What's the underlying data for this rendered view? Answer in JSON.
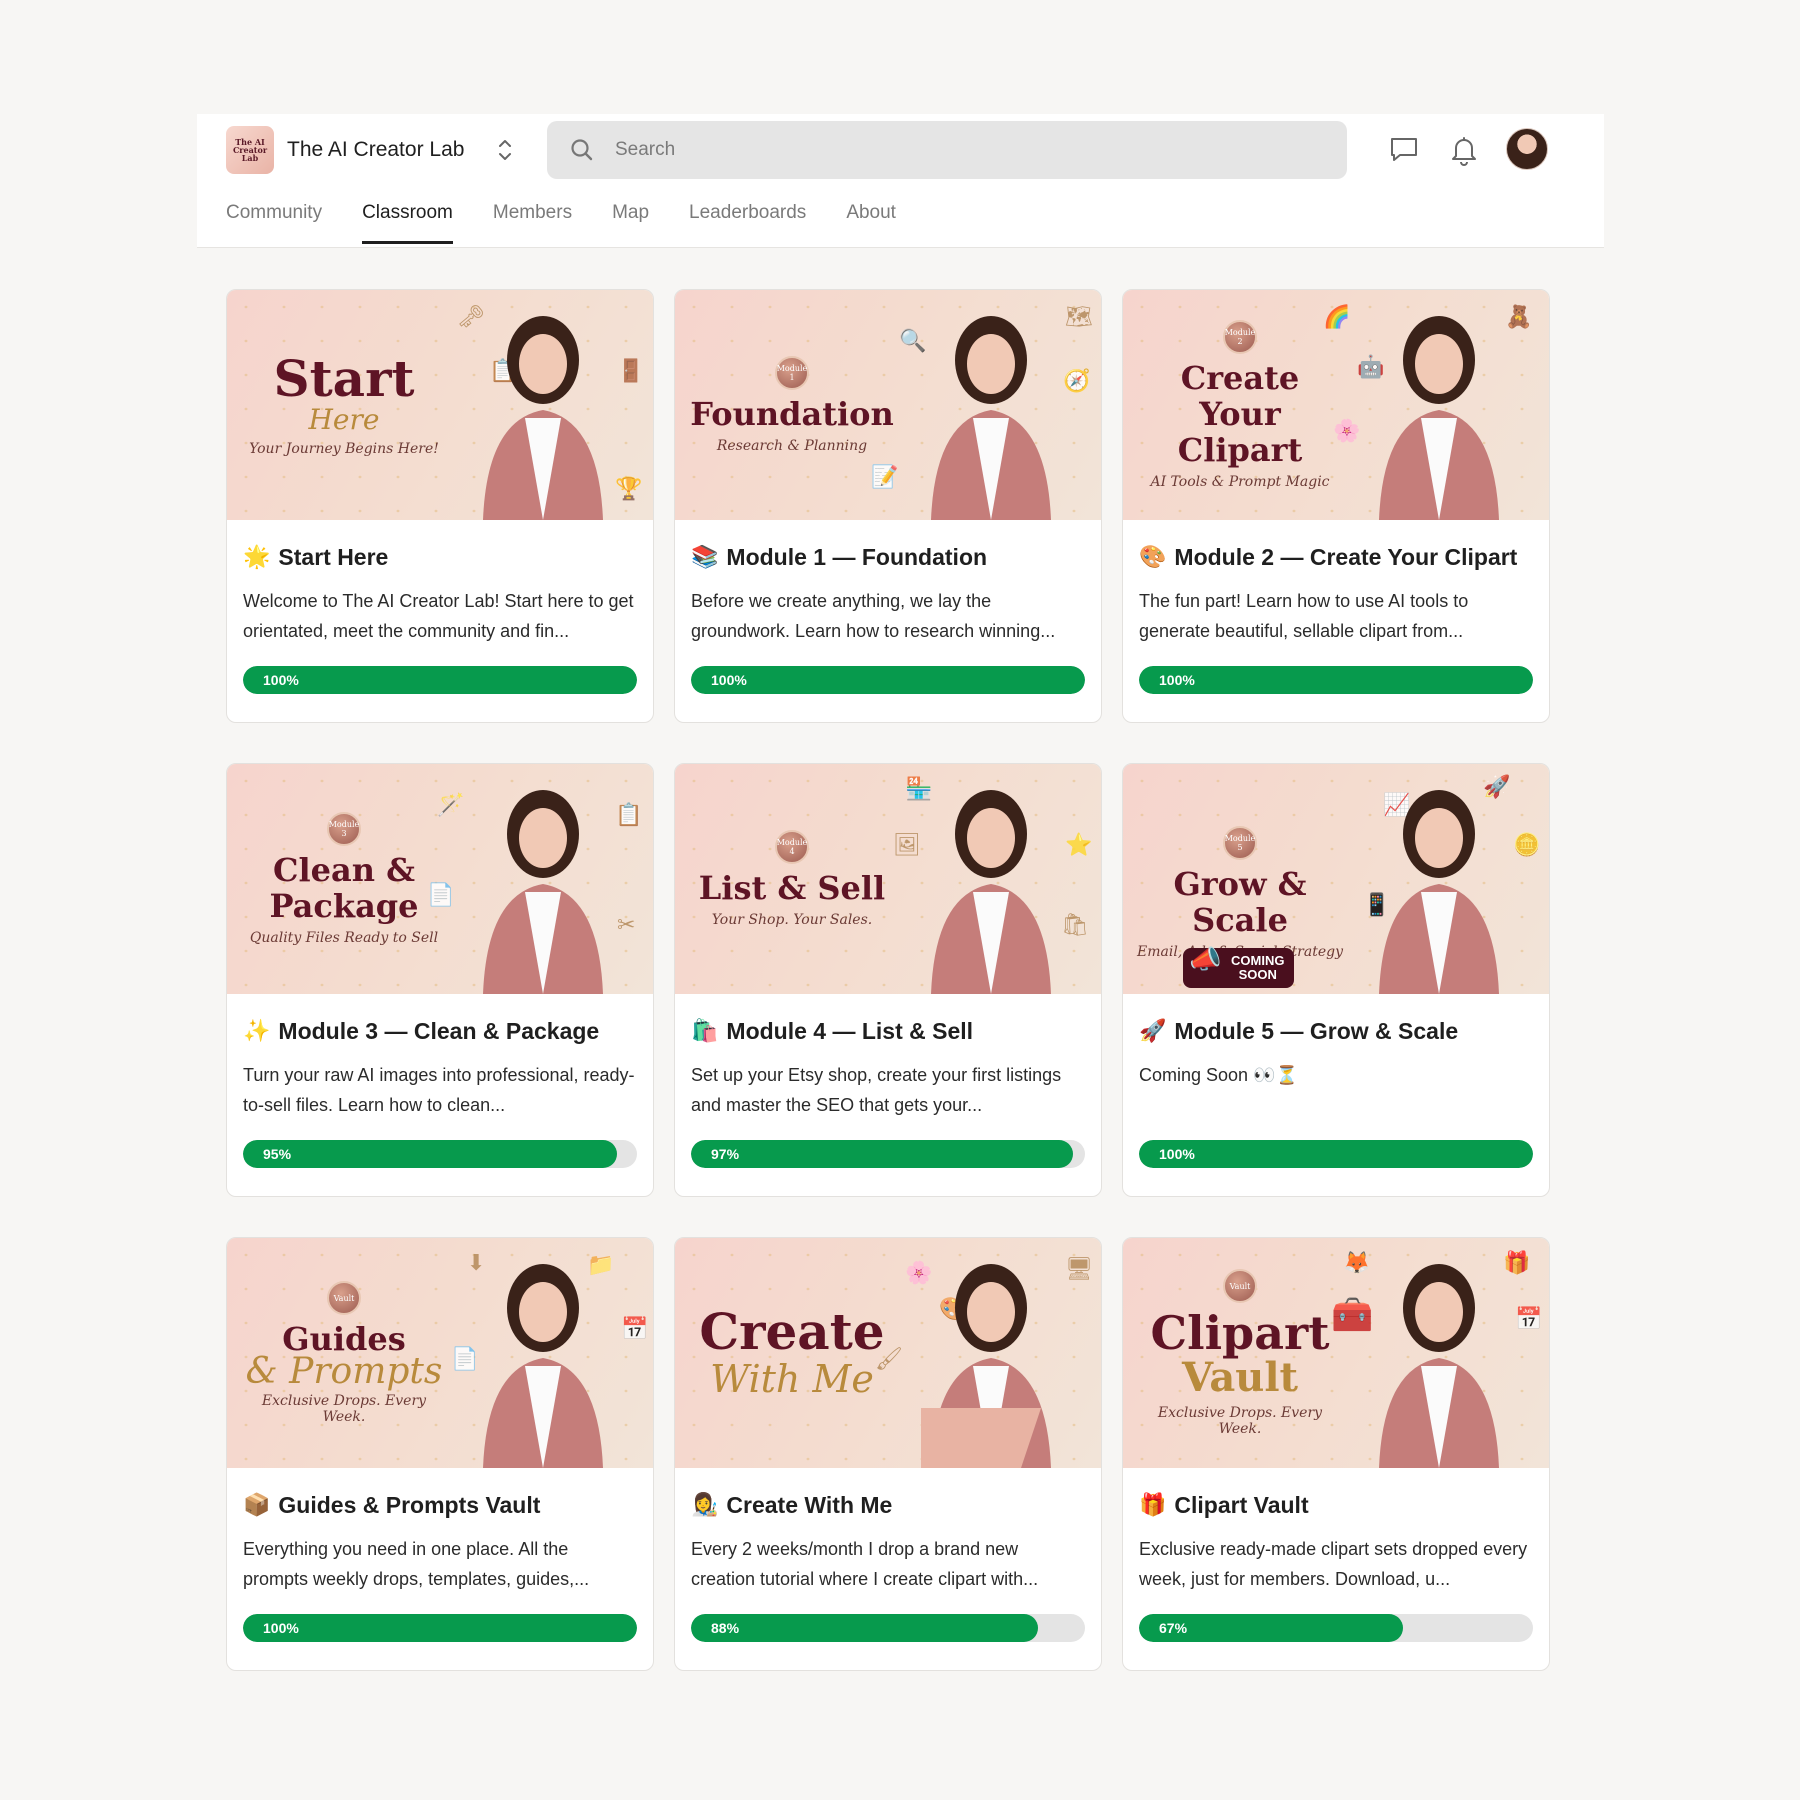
{
  "brand": {
    "name": "The AI Creator Lab",
    "logo_text": "The AI Creator Lab"
  },
  "search": {
    "placeholder": "Search"
  },
  "header_icons": [
    "chat-icon",
    "bell-icon",
    "user-avatar"
  ],
  "nav": {
    "tabs": [
      {
        "label": "Community",
        "active": false
      },
      {
        "label": "Classroom",
        "active": true
      },
      {
        "label": "Members",
        "active": false
      },
      {
        "label": "Map",
        "active": false
      },
      {
        "label": "Leaderboards",
        "active": false
      },
      {
        "label": "About",
        "active": false
      }
    ]
  },
  "colors": {
    "progress": "#079a4d",
    "progress_track": "#e4e4e4",
    "cover_title": "#5e1425",
    "cover_script": "#b88a3c"
  },
  "courses": [
    {
      "emoji": "🌟",
      "title": "Start Here",
      "description": "Welcome to The AI Creator Lab! Start here to get orientated, meet the community and fin...",
      "progress": 100,
      "progress_label": "100%",
      "cover": {
        "badge": "",
        "main": "Start",
        "script": "Here",
        "tag": "Your Journey Begins Here!"
      }
    },
    {
      "emoji": "📚",
      "title": "Module 1 — Foundation",
      "description": "Before we create anything, we lay the groundwork. Learn how to research winning...",
      "progress": 100,
      "progress_label": "100%",
      "cover": {
        "badge": "Module 1",
        "main": "Foundation",
        "script": "",
        "tag": "Research & Planning"
      }
    },
    {
      "emoji": "🎨",
      "title": "Module 2 — Create Your Clipart",
      "description": "The fun part! Learn how to use AI tools to generate beautiful, sellable clipart from...",
      "progress": 100,
      "progress_label": "100%",
      "cover": {
        "badge": "Module 2",
        "main": "Create Your Clipart",
        "script": "",
        "tag": "AI Tools & Prompt Magic"
      }
    },
    {
      "emoji": "✨",
      "title": "Module 3 — Clean & Package",
      "description": "Turn your raw AI images into professional, ready-to-sell files. Learn how to clean...",
      "progress": 95,
      "progress_label": "95%",
      "cover": {
        "badge": "Module 3",
        "main": "Clean & Package",
        "script": "",
        "tag": "Quality Files Ready to Sell"
      }
    },
    {
      "emoji": "🛍️",
      "title": "Module 4 — List & Sell",
      "description": "Set up your Etsy shop, create your first listings and master the SEO that gets your...",
      "progress": 97,
      "progress_label": "97%",
      "cover": {
        "badge": "Module 4",
        "main": "List & Sell",
        "script": "",
        "tag": "Your Shop. Your Sales."
      }
    },
    {
      "emoji": "🚀",
      "title": "Module 5 — Grow & Scale",
      "description": "Coming Soon 👀⏳",
      "progress": 100,
      "progress_label": "100%",
      "cover": {
        "badge": "Module 5",
        "main": "Grow & Scale",
        "script": "",
        "tag": "Email, Ads & Social Strategy",
        "sticker_top": "COMING",
        "sticker_bottom": "SOON"
      }
    },
    {
      "emoji": "📦",
      "title": "Guides & Prompts Vault",
      "description": "Everything you need in one place. All the prompts weekly drops, templates, guides,...",
      "progress": 100,
      "progress_label": "100%",
      "cover": {
        "badge": "Vault",
        "main": "Guides",
        "script": "& Prompts",
        "tag": "Exclusive Drops. Every Week."
      }
    },
    {
      "emoji": "👩‍🎨",
      "title": "Create With Me",
      "description": "Every 2 weeks/month I drop a brand new creation tutorial where I create clipart with...",
      "progress": 88,
      "progress_label": "88%",
      "cover": {
        "badge": "",
        "main": "Create",
        "script": "With Me",
        "tag": ""
      }
    },
    {
      "emoji": "🎁",
      "title": "Clipart Vault",
      "description": "Exclusive ready-made clipart sets dropped every week, just for members. Download, u...",
      "progress": 67,
      "progress_label": "67%",
      "cover": {
        "badge": "Vault",
        "main": "Clipart",
        "script": "Vault",
        "tag": "Exclusive Drops. Every Week."
      }
    }
  ]
}
